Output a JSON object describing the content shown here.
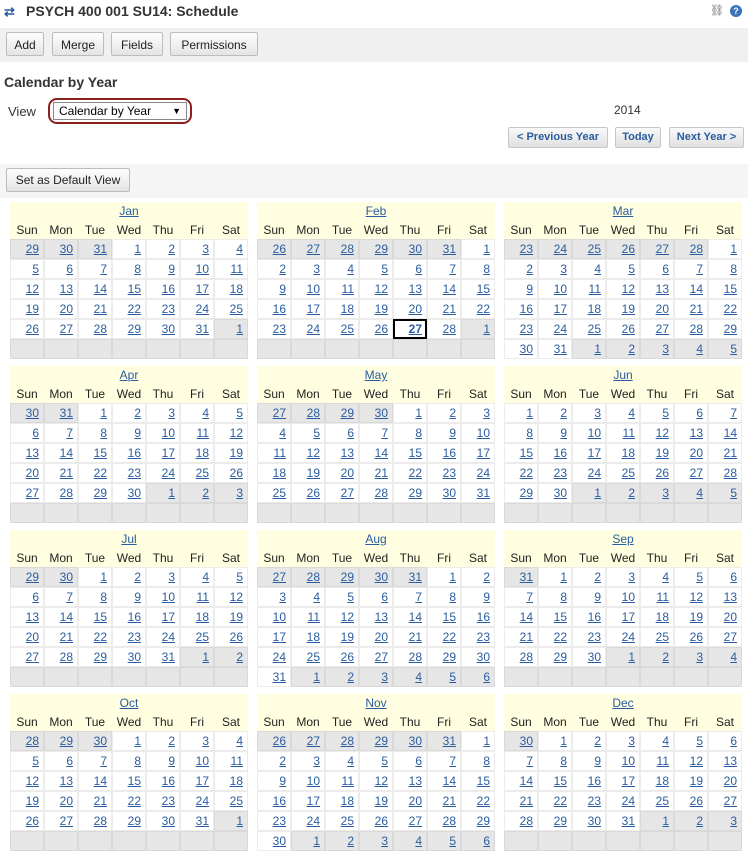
{
  "header": {
    "title": "PSYCH 400 001 SU14: Schedule",
    "icons": [
      "refresh-arrows-icon",
      "link-icon",
      "help-icon"
    ],
    "help_glyph": "?"
  },
  "toolbar": {
    "add": "Add",
    "merge": "Merge",
    "fields": "Fields",
    "permissions": "Permissions"
  },
  "section_title": "Calendar by Year",
  "view": {
    "label": "View",
    "selected": "Calendar by Year"
  },
  "year": "2014",
  "nav": {
    "prev": "< Previous Year",
    "today": "Today",
    "next": "Next Year >"
  },
  "default_view_button": "Set as Default View",
  "today": {
    "month": "Feb",
    "day": 27
  },
  "colors": {
    "link": "#2a5d9f",
    "header_bg": "#fffee0",
    "out_of_month": "#e6e6e6",
    "select_highlight": "#8e1f1f"
  },
  "calendar": {
    "weekdays": [
      "Sun",
      "Mon",
      "Tue",
      "Wed",
      "Thu",
      "Fri",
      "Sat"
    ],
    "months": [
      {
        "name": "Jan",
        "weeks": [
          [
            "29",
            "30",
            "31",
            "1",
            "2",
            "3",
            "4"
          ],
          [
            "5",
            "6",
            "7",
            "8",
            "9",
            "10",
            "11"
          ],
          [
            "12",
            "13",
            "14",
            "15",
            "16",
            "17",
            "18"
          ],
          [
            "19",
            "20",
            "21",
            "22",
            "23",
            "24",
            "25"
          ],
          [
            "26",
            "27",
            "28",
            "29",
            "30",
            "31",
            "1"
          ],
          [
            "",
            "",
            "",
            "",
            "",
            "",
            ""
          ]
        ]
      },
      {
        "name": "Feb",
        "weeks": [
          [
            "26",
            "27",
            "28",
            "29",
            "30",
            "31",
            "1"
          ],
          [
            "2",
            "3",
            "4",
            "5",
            "6",
            "7",
            "8"
          ],
          [
            "9",
            "10",
            "11",
            "12",
            "13",
            "14",
            "15"
          ],
          [
            "16",
            "17",
            "18",
            "19",
            "20",
            "21",
            "22"
          ],
          [
            "23",
            "24",
            "25",
            "26",
            "27",
            "28",
            "1"
          ],
          [
            "",
            "",
            "",
            "",
            "",
            "",
            ""
          ]
        ]
      },
      {
        "name": "Mar",
        "weeks": [
          [
            "23",
            "24",
            "25",
            "26",
            "27",
            "28",
            "1"
          ],
          [
            "2",
            "3",
            "4",
            "5",
            "6",
            "7",
            "8"
          ],
          [
            "9",
            "10",
            "11",
            "12",
            "13",
            "14",
            "15"
          ],
          [
            "16",
            "17",
            "18",
            "19",
            "20",
            "21",
            "22"
          ],
          [
            "23",
            "24",
            "25",
            "26",
            "27",
            "28",
            "29"
          ],
          [
            "30",
            "31",
            "1",
            "2",
            "3",
            "4",
            "5"
          ]
        ]
      },
      {
        "name": "Apr",
        "weeks": [
          [
            "30",
            "31",
            "1",
            "2",
            "3",
            "4",
            "5"
          ],
          [
            "6",
            "7",
            "8",
            "9",
            "10",
            "11",
            "12"
          ],
          [
            "13",
            "14",
            "15",
            "16",
            "17",
            "18",
            "19"
          ],
          [
            "20",
            "21",
            "22",
            "23",
            "24",
            "25",
            "26"
          ],
          [
            "27",
            "28",
            "29",
            "30",
            "1",
            "2",
            "3"
          ],
          [
            "",
            "",
            "",
            "",
            "",
            "",
            ""
          ]
        ]
      },
      {
        "name": "May",
        "weeks": [
          [
            "27",
            "28",
            "29",
            "30",
            "1",
            "2",
            "3"
          ],
          [
            "4",
            "5",
            "6",
            "7",
            "8",
            "9",
            "10"
          ],
          [
            "11",
            "12",
            "13",
            "14",
            "15",
            "16",
            "17"
          ],
          [
            "18",
            "19",
            "20",
            "21",
            "22",
            "23",
            "24"
          ],
          [
            "25",
            "26",
            "27",
            "28",
            "29",
            "30",
            "31"
          ],
          [
            "",
            "",
            "",
            "",
            "",
            "",
            ""
          ]
        ]
      },
      {
        "name": "Jun",
        "weeks": [
          [
            "1",
            "2",
            "3",
            "4",
            "5",
            "6",
            "7"
          ],
          [
            "8",
            "9",
            "10",
            "11",
            "12",
            "13",
            "14"
          ],
          [
            "15",
            "16",
            "17",
            "18",
            "19",
            "20",
            "21"
          ],
          [
            "22",
            "23",
            "24",
            "25",
            "26",
            "27",
            "28"
          ],
          [
            "29",
            "30",
            "1",
            "2",
            "3",
            "4",
            "5"
          ],
          [
            "",
            "",
            "",
            "",
            "",
            "",
            ""
          ]
        ]
      },
      {
        "name": "Jul",
        "weeks": [
          [
            "29",
            "30",
            "1",
            "2",
            "3",
            "4",
            "5"
          ],
          [
            "6",
            "7",
            "8",
            "9",
            "10",
            "11",
            "12"
          ],
          [
            "13",
            "14",
            "15",
            "16",
            "17",
            "18",
            "19"
          ],
          [
            "20",
            "21",
            "22",
            "23",
            "24",
            "25",
            "26"
          ],
          [
            "27",
            "28",
            "29",
            "30",
            "31",
            "1",
            "2"
          ],
          [
            "",
            "",
            "",
            "",
            "",
            "",
            ""
          ]
        ]
      },
      {
        "name": "Aug",
        "weeks": [
          [
            "27",
            "28",
            "29",
            "30",
            "31",
            "1",
            "2"
          ],
          [
            "3",
            "4",
            "5",
            "6",
            "7",
            "8",
            "9"
          ],
          [
            "10",
            "11",
            "12",
            "13",
            "14",
            "15",
            "16"
          ],
          [
            "17",
            "18",
            "19",
            "20",
            "21",
            "22",
            "23"
          ],
          [
            "24",
            "25",
            "26",
            "27",
            "28",
            "29",
            "30"
          ],
          [
            "31",
            "1",
            "2",
            "3",
            "4",
            "5",
            "6"
          ]
        ]
      },
      {
        "name": "Sep",
        "weeks": [
          [
            "31",
            "1",
            "2",
            "3",
            "4",
            "5",
            "6"
          ],
          [
            "7",
            "8",
            "9",
            "10",
            "11",
            "12",
            "13"
          ],
          [
            "14",
            "15",
            "16",
            "17",
            "18",
            "19",
            "20"
          ],
          [
            "21",
            "22",
            "23",
            "24",
            "25",
            "26",
            "27"
          ],
          [
            "28",
            "29",
            "30",
            "1",
            "2",
            "3",
            "4"
          ],
          [
            "",
            "",
            "",
            "",
            "",
            "",
            ""
          ]
        ]
      },
      {
        "name": "Oct",
        "weeks": [
          [
            "28",
            "29",
            "30",
            "1",
            "2",
            "3",
            "4"
          ],
          [
            "5",
            "6",
            "7",
            "8",
            "9",
            "10",
            "11"
          ],
          [
            "12",
            "13",
            "14",
            "15",
            "16",
            "17",
            "18"
          ],
          [
            "19",
            "20",
            "21",
            "22",
            "23",
            "24",
            "25"
          ],
          [
            "26",
            "27",
            "28",
            "29",
            "30",
            "31",
            "1"
          ],
          [
            "",
            "",
            "",
            "",
            "",
            "",
            ""
          ]
        ]
      },
      {
        "name": "Nov",
        "weeks": [
          [
            "26",
            "27",
            "28",
            "29",
            "30",
            "31",
            "1"
          ],
          [
            "2",
            "3",
            "4",
            "5",
            "6",
            "7",
            "8"
          ],
          [
            "9",
            "10",
            "11",
            "12",
            "13",
            "14",
            "15"
          ],
          [
            "16",
            "17",
            "18",
            "19",
            "20",
            "21",
            "22"
          ],
          [
            "23",
            "24",
            "25",
            "26",
            "27",
            "28",
            "29"
          ],
          [
            "30",
            "1",
            "2",
            "3",
            "4",
            "5",
            "6"
          ]
        ]
      },
      {
        "name": "Dec",
        "weeks": [
          [
            "30",
            "1",
            "2",
            "3",
            "4",
            "5",
            "6"
          ],
          [
            "7",
            "8",
            "9",
            "10",
            "11",
            "12",
            "13"
          ],
          [
            "14",
            "15",
            "16",
            "17",
            "18",
            "19",
            "20"
          ],
          [
            "21",
            "22",
            "23",
            "24",
            "25",
            "26",
            "27"
          ],
          [
            "28",
            "29",
            "30",
            "31",
            "1",
            "2",
            "3"
          ],
          [
            "",
            "",
            "",
            "",
            "",
            "",
            ""
          ]
        ]
      }
    ]
  }
}
